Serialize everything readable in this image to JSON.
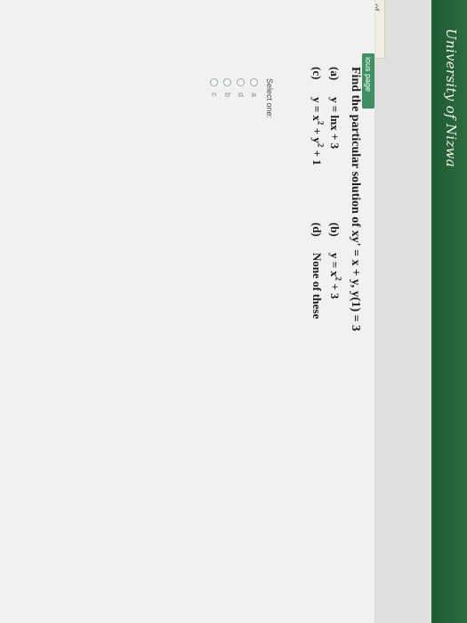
{
  "header": {
    "site_title": "University of Nizwa"
  },
  "sidebar": {
    "fragment_text": "of",
    "nav_button_label": "ious page"
  },
  "question": {
    "prompt_prefix": "Find the particular solution of xy",
    "prompt_suffix": "' = x + y, y(1) = 3",
    "choices": [
      {
        "letter": "(a)",
        "text": "y = lnx + 3"
      },
      {
        "letter": "(b)",
        "text_main": "y = x",
        "text_sup": "2",
        "text_tail": " + 3"
      },
      {
        "letter": "(c)",
        "text_main": "y = x",
        "text_sup": "2",
        "text_mid": " + y",
        "text_sup2": "2",
        "text_tail": " + 1"
      },
      {
        "letter": "(d)",
        "text": "None of these"
      }
    ]
  },
  "answer_options": {
    "label": "Select one:",
    "items": [
      "a",
      "d",
      "b",
      "c"
    ]
  },
  "colors": {
    "header_green": "#2c6a3e",
    "button_green": "#3f8f63",
    "card_background": "#f1f1ef"
  }
}
